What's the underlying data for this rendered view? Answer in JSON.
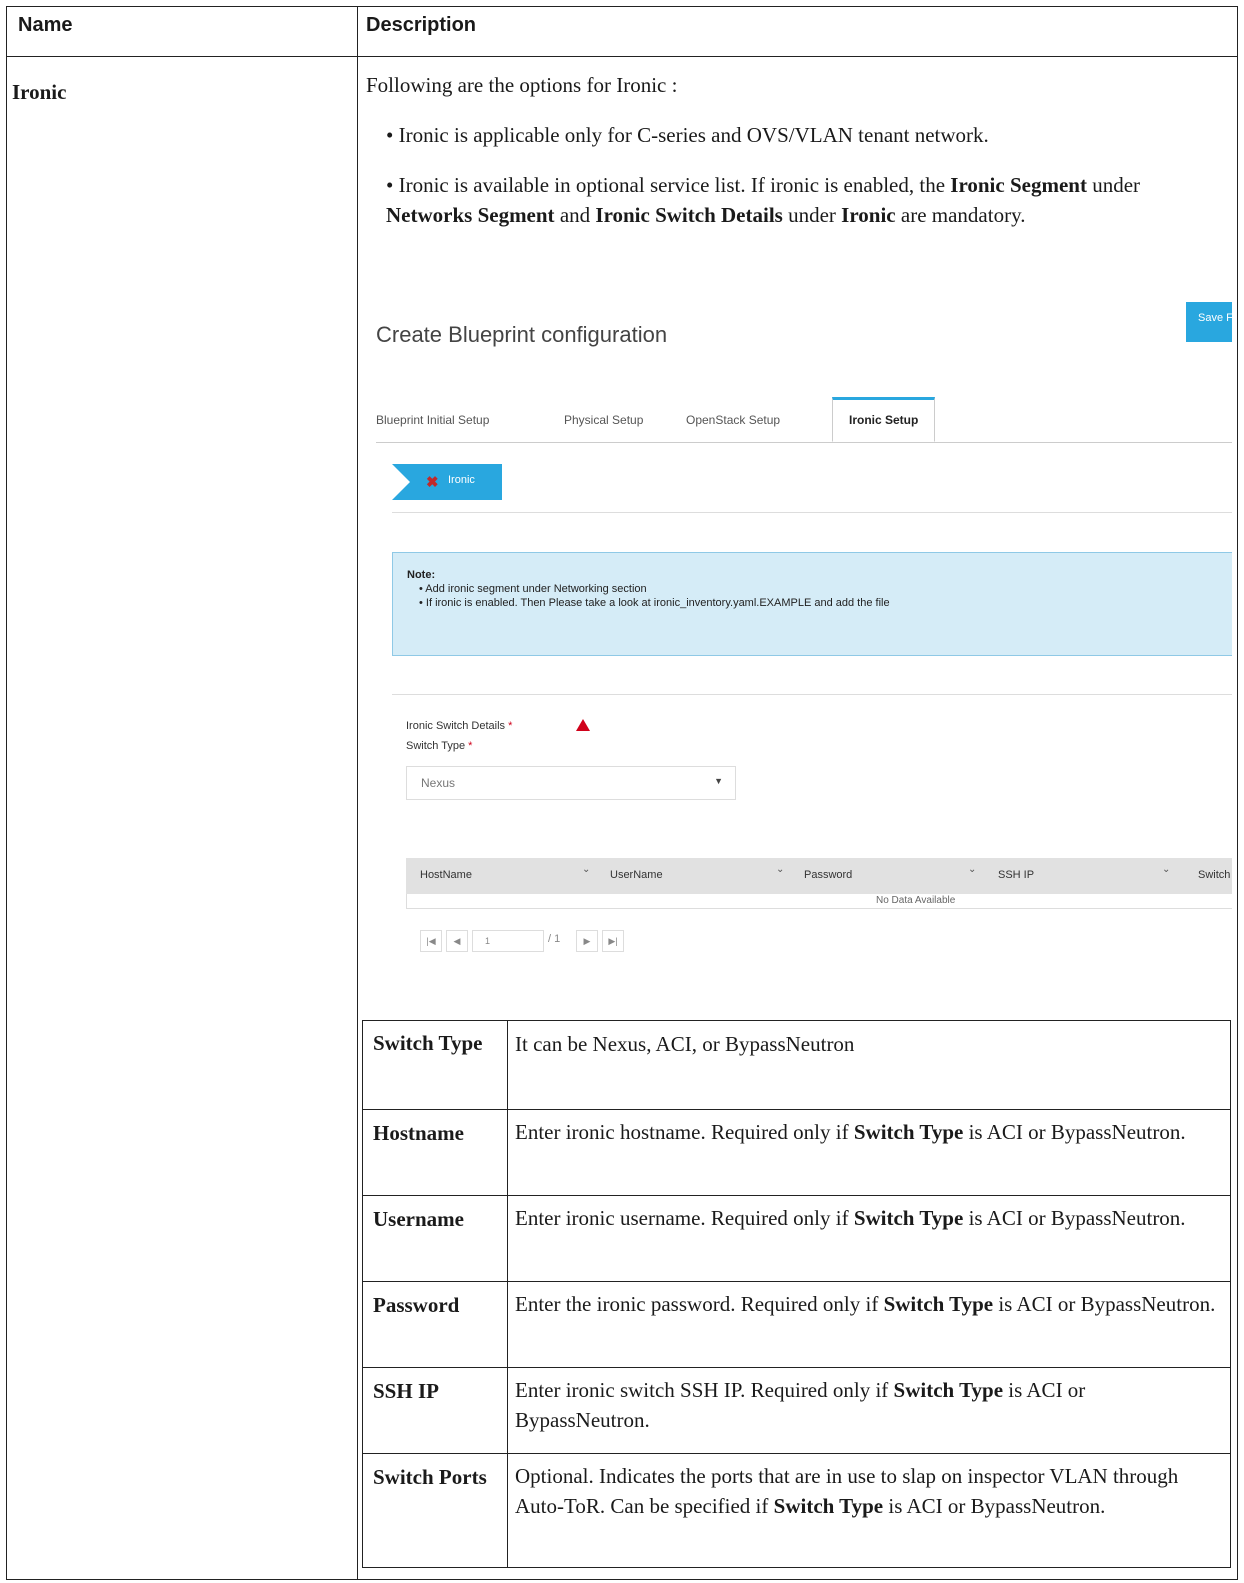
{
  "header": {
    "name": "Name",
    "description": "Description"
  },
  "row": {
    "name": "Ironic",
    "intro": "Following are the options for Ironic :",
    "bullet1": "• Ironic is applicable only for C-series and OVS/VLAN tenant network.",
    "bullet2": {
      "p1": "• Ironic is available in optional service list. If ironic is enabled, the ",
      "b1": "Ironic Segment",
      "p2": " under ",
      "b2": "Networks Segment",
      "p3": " and ",
      "b3": "Ironic Switch Details",
      "p4": " under ",
      "b4": "Ironic",
      "p5": " are mandatory."
    }
  },
  "screenshot": {
    "title": "Create Blueprint configuration",
    "save_label": "Save F",
    "tabs": [
      "Blueprint Initial Setup",
      "Physical Setup",
      "OpenStack Setup",
      "Ironic Setup"
    ],
    "step_label": "Ironic",
    "note_title": "Note:",
    "note_items": [
      "• Add ironic segment under Networking section",
      "• If ironic is enabled. Then Please take a look at ironic_inventory.yaml.EXAMPLE and add the file"
    ],
    "switch_details_label": "Ironic Switch Details",
    "switch_type_label": "Switch Type",
    "required_mark": "*",
    "switch_type_value": "Nexus",
    "columns": [
      "HostName",
      "UserName",
      "Password",
      "SSH IP",
      "Switch"
    ],
    "no_data": "No Data Available",
    "pager": {
      "first": "|◀",
      "prev": "◀",
      "page": "1",
      "of": "/ 1",
      "next": "▶",
      "last": "▶|"
    }
  },
  "fields": [
    {
      "name": "Switch Type",
      "pre": "It can be Nexus, ACI, or BypassNeutron",
      "bold": "",
      "post": ""
    },
    {
      "name": "Hostname",
      "pre": "Enter ironic hostname. Required only if ",
      "bold": "Switch Type",
      "post": " is ACI or BypassNeutron."
    },
    {
      "name": "Username",
      "pre": "Enter ironic username. Required only if ",
      "bold": "Switch Type",
      "post": " is ACI or BypassNeutron."
    },
    {
      "name": "Password",
      "pre": "Enter the ironic password. Required only if ",
      "bold": "Switch Type",
      "post": " is ACI or BypassNeutron."
    },
    {
      "name": "SSH IP",
      "pre": "Enter ironic switch SSH IP. Required only if ",
      "bold": "Switch Type",
      "post": " is ACI or BypassNeutron."
    },
    {
      "name": "Switch Ports",
      "pre": "Optional. Indicates the ports that are in use to slap on inspector VLAN through Auto-ToR. Can be specified if ",
      "bold": "Switch Type",
      "post": " is ACI or BypassNeutron."
    }
  ]
}
